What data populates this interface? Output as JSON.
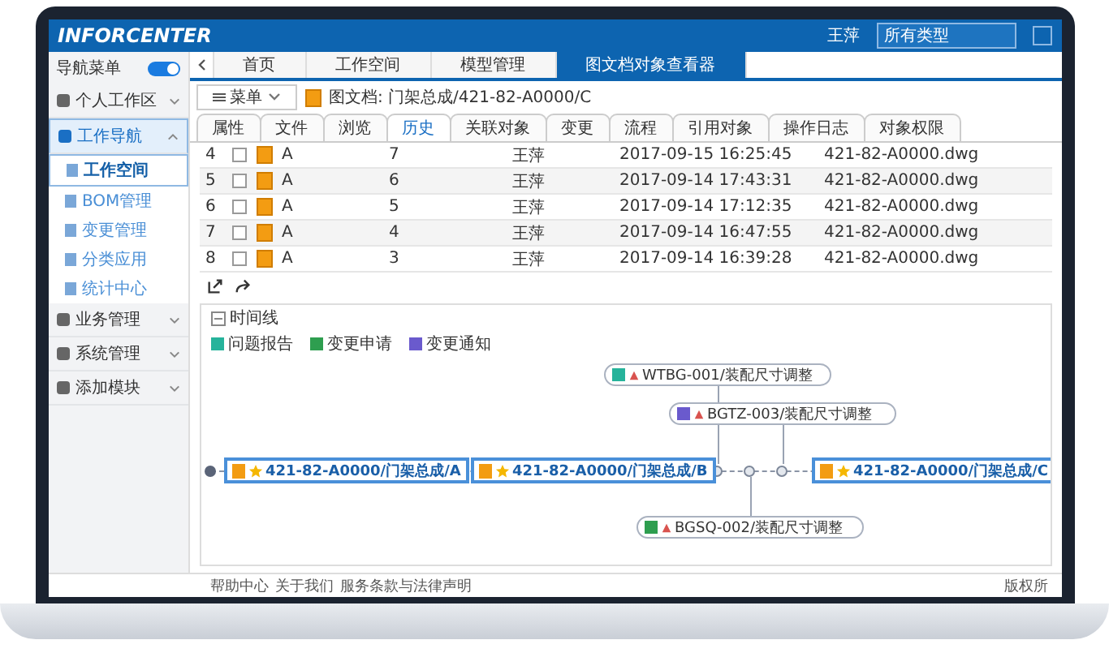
{
  "header": {
    "logo": "INFORCENTER",
    "user": "王萍",
    "search_type": "所有类型"
  },
  "nav": {
    "title": "导航菜单",
    "on": true,
    "items": [
      {
        "label": "个人工作区",
        "expanded": false,
        "selected": false
      },
      {
        "label": "工作导航",
        "expanded": true,
        "selected": true,
        "children": [
          {
            "label": "工作空间",
            "selected": true
          },
          {
            "label": "BOM管理",
            "selected": false
          },
          {
            "label": "变更管理",
            "selected": false
          },
          {
            "label": "分类应用",
            "selected": false
          },
          {
            "label": "统计中心",
            "selected": false
          }
        ]
      },
      {
        "label": "业务管理",
        "expanded": false,
        "selected": false
      },
      {
        "label": "系统管理",
        "expanded": false,
        "selected": false
      },
      {
        "label": "添加模块",
        "expanded": false,
        "selected": false
      }
    ]
  },
  "tabs": [
    {
      "label": "首页",
      "selected": false
    },
    {
      "label": "工作空间",
      "selected": false
    },
    {
      "label": "模型管理",
      "selected": false
    },
    {
      "label": "图文档对象查看器",
      "selected": true
    }
  ],
  "toolbar": {
    "menu": "菜单",
    "doc_title": "图文档: 门架总成/421-82-A0000/C"
  },
  "subtabs": [
    {
      "label": "属性",
      "selected": false
    },
    {
      "label": "文件",
      "selected": false
    },
    {
      "label": "浏览",
      "selected": false
    },
    {
      "label": "历史",
      "selected": true
    },
    {
      "label": "关联对象",
      "selected": false
    },
    {
      "label": "变更",
      "selected": false
    },
    {
      "label": "流程",
      "selected": false
    },
    {
      "label": "引用对象",
      "selected": false
    },
    {
      "label": "操作日志",
      "selected": false
    },
    {
      "label": "对象权限",
      "selected": false
    }
  ],
  "table": {
    "rows": [
      {
        "index": "4",
        "checked": false,
        "column_4": "A",
        "version": "7",
        "user": "王萍",
        "time": "2017-09-15 16:25:45",
        "file": "421-82-A0000.dwg"
      },
      {
        "index": "5",
        "checked": false,
        "column_4": "A",
        "version": "6",
        "user": "王萍",
        "time": "2017-09-14 17:43:31",
        "file": "421-82-A0000.dwg"
      },
      {
        "index": "6",
        "checked": false,
        "column_4": "A",
        "version": "5",
        "user": "王萍",
        "time": "2017-09-14 17:12:35",
        "file": "421-82-A0000.dwg"
      },
      {
        "index": "7",
        "checked": false,
        "column_4": "A",
        "version": "4",
        "user": "王萍",
        "time": "2017-09-14 16:47:55",
        "file": "421-82-A0000.dwg"
      },
      {
        "index": "8",
        "checked": false,
        "column_4": "A",
        "version": "3",
        "user": "王萍",
        "time": "2017-09-14 16:39:28",
        "file": "421-82-A0000.dwg"
      }
    ]
  },
  "timeline": {
    "title": "时间线",
    "expanded": true,
    "legend": [
      {
        "label": "问题报告",
        "color": "#26b39b"
      },
      {
        "label": "变更申请",
        "color": "#2e9e4f"
      },
      {
        "label": "变更通知",
        "color": "#6a5acd"
      }
    ],
    "versions": [
      {
        "label": "421-82-A0000/门架总成/A"
      },
      {
        "label": "421-82-A0000/门架总成/B"
      },
      {
        "label": "421-82-A0000/门架总成/C"
      }
    ],
    "events": [
      {
        "label": "WTBG-001/装配尺寸调整",
        "color": "#26b39b"
      },
      {
        "label": "BGTZ-003/装配尺寸调整",
        "color": "#6a5acd"
      },
      {
        "label": "BGSQ-002/装配尺寸调整",
        "color": "#2e9e4f"
      }
    ]
  },
  "footer": {
    "links": [
      "帮助中心",
      "关于我们",
      "服务条款与法律声明"
    ],
    "copyright": "版权所"
  }
}
